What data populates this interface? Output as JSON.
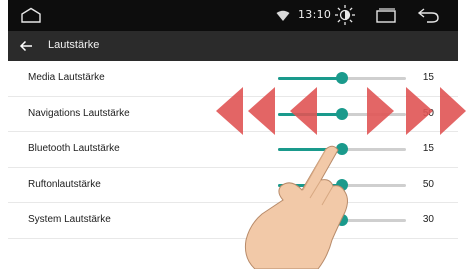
{
  "status_bar": {
    "time": "13:10",
    "icons": [
      "home-icon",
      "wifi-icon",
      "brightness-icon",
      "recents-icon",
      "back-icon"
    ]
  },
  "app_bar": {
    "title": "Lautstärke",
    "back_icon": "arrow-left-icon"
  },
  "volume_rows": [
    {
      "label": "Media Lautstärke",
      "value": "15",
      "level": 0.5
    },
    {
      "label": "Navigations Lautstärke",
      "value": "50",
      "level": 0.5
    },
    {
      "label": "Bluetooth Lautstärke",
      "value": "15",
      "level": 0.5
    },
    {
      "label": "Ruftonlautstärke",
      "value": "50",
      "level": 0.5
    },
    {
      "label": "System Lautstärke",
      "value": "30",
      "level": 0.5
    }
  ],
  "colors": {
    "accent": "#1a9a8c",
    "status_bar": "#0d0d0d",
    "app_bar": "#2b2b2b",
    "swipe_arrows": "#e05555"
  },
  "overlay": {
    "gesture": "swipe-left-right",
    "icons": [
      "swipe-left-arrows-icon",
      "swipe-right-arrows-icon",
      "hand-pointer-icon"
    ]
  }
}
